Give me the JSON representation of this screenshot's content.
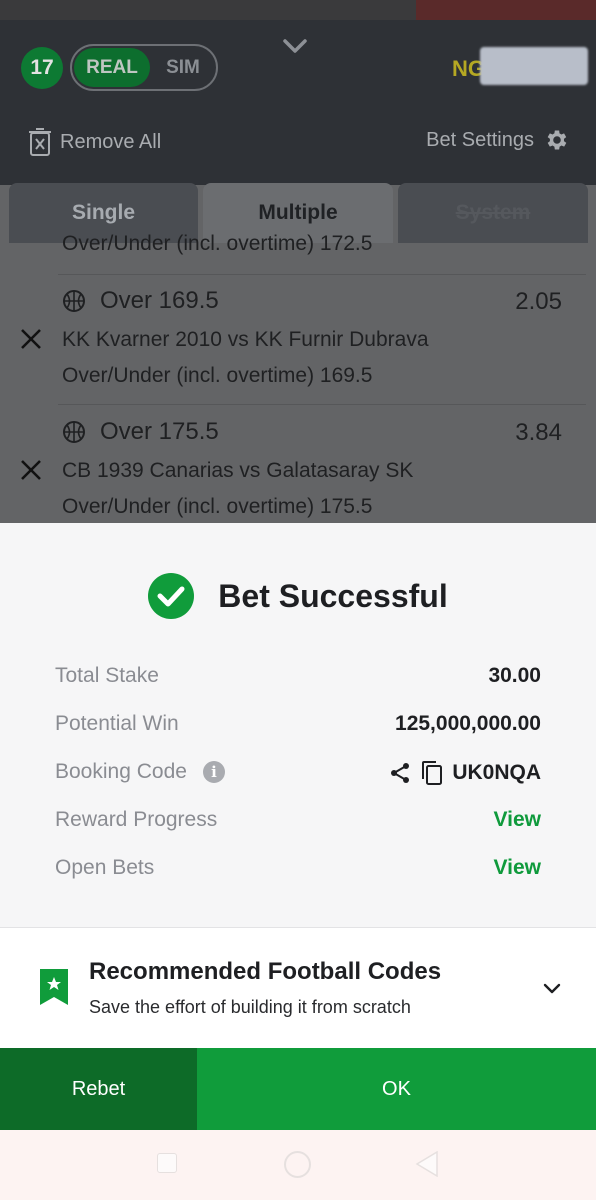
{
  "header": {
    "bet_count": "17",
    "mode_real": "REAL",
    "mode_sim": "SIM",
    "currency": "NG",
    "remove_all": "Remove All",
    "bet_settings": "Bet Settings"
  },
  "tabs": [
    {
      "label": "Single",
      "active": false
    },
    {
      "label": "Multiple",
      "active": true
    },
    {
      "label": "System",
      "active": false,
      "disabled": true
    }
  ],
  "selections": [
    {
      "market_line": "Over/Under (incl. overtime) 172.5"
    },
    {
      "pick": "Over 169.5",
      "odds": "2.05",
      "match": "KK Kvarner 2010 vs KK Furnir Dubrava",
      "market_line": "Over/Under (incl. overtime) 169.5",
      "sport_icon": "basketball-icon"
    },
    {
      "pick": "Over 175.5",
      "odds": "3.84",
      "match": "CB 1939 Canarias vs Galatasaray SK",
      "market_line": "Over/Under (incl. overtime) 175.5",
      "sport_icon": "basketball-icon"
    }
  ],
  "result": {
    "title": "Bet Successful",
    "total_stake_label": "Total Stake",
    "total_stake": "30.00",
    "potential_win_label": "Potential Win",
    "potential_win": "125,000,000.00",
    "booking_code_label": "Booking Code",
    "booking_code": "UK0NQA",
    "reward_progress_label": "Reward Progress",
    "reward_progress_link": "View",
    "open_bets_label": "Open Bets",
    "open_bets_link": "View"
  },
  "recommended": {
    "title": "Recommended Football Codes",
    "subtitle": "Save the effort of building it from scratch"
  },
  "actions": {
    "rebet": "Rebet",
    "ok": "OK"
  },
  "colors": {
    "brand_green": "#109c3b",
    "dark_green": "#0d6b28",
    "link_green": "#0f9a3c"
  }
}
